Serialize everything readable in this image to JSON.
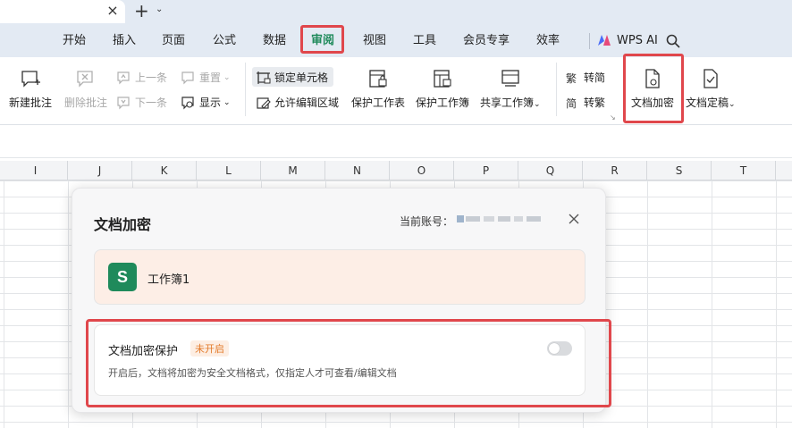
{
  "titlebar": {
    "close_glyph": "×",
    "new_tab_glyph": "+",
    "new_tab_arrow": "⌄"
  },
  "menu": {
    "items": [
      "开始",
      "插入",
      "页面",
      "公式",
      "数据",
      "审阅",
      "视图",
      "工具",
      "会员专享",
      "效率"
    ],
    "active": "审阅",
    "wps_ai": "WPS AI"
  },
  "ribbon": {
    "new_comment": "新建批注",
    "delete_comment": "删除批注",
    "prev": "上一条",
    "next": "下一条",
    "reset": "重置",
    "show": "显示",
    "lock_cell": "锁定单元格",
    "allow_edit_range": "允许编辑区域",
    "protect_sheet": "保护工作表",
    "protect_workbook": "保护工作簿",
    "share_workbook": "共享工作簿",
    "to_simplified": "转简",
    "to_traditional": "转繁",
    "doc_encrypt": "文档加密",
    "doc_finalize": "文档定稿"
  },
  "grid": {
    "columns": [
      "I",
      "J",
      "K",
      "L",
      "M",
      "N",
      "O",
      "P",
      "Q",
      "R",
      "S",
      "T"
    ]
  },
  "dialog": {
    "title": "文档加密",
    "account_label": "当前账号：",
    "file_icon_letter": "S",
    "file_name": "工作簿1",
    "protect_title": "文档加密保护",
    "protect_status": "未开启",
    "protect_desc": "开启后，文档将加密为安全文档格式，仅指定人才可查看/编辑文档"
  },
  "colors": {
    "accent": "#1f8a5b",
    "highlight": "#e0474c",
    "status": "#e37a2a"
  }
}
